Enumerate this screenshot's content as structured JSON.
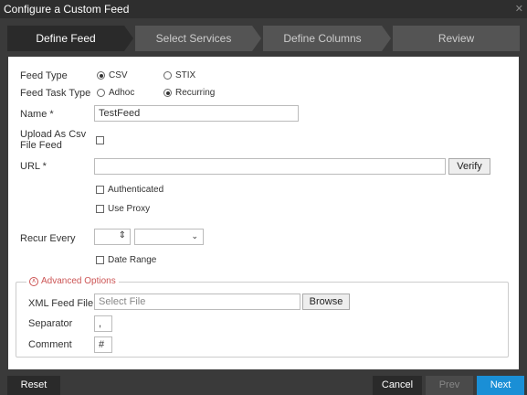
{
  "window": {
    "title": "Configure a Custom Feed",
    "close_icon": "close-icon"
  },
  "wizard": {
    "steps": [
      {
        "label": "Define Feed",
        "active": true
      },
      {
        "label": "Select Services",
        "active": false
      },
      {
        "label": "Define Columns",
        "active": false
      },
      {
        "label": "Review",
        "active": false
      }
    ]
  },
  "form": {
    "feed_type": {
      "label": "Feed Type",
      "options": [
        "CSV",
        "STIX"
      ],
      "selected": "CSV"
    },
    "feed_task_type": {
      "label": "Feed Task Type",
      "options": [
        "Adhoc",
        "Recurring"
      ],
      "selected": "Recurring"
    },
    "name": {
      "label": "Name *",
      "value": "TestFeed"
    },
    "upload_csv": {
      "label_line1": "Upload As Csv",
      "label_line2": "File Feed"
    },
    "url": {
      "label": "URL *",
      "value": "",
      "verify_label": "Verify"
    },
    "authenticated": {
      "label": "Authenticated"
    },
    "use_proxy": {
      "label": "Use Proxy"
    },
    "recur_every": {
      "label": "Recur Every",
      "value": "",
      "unit": ""
    },
    "date_range": {
      "label": "Date Range"
    },
    "advanced": {
      "legend": "Advanced Options",
      "xml_feed_file": {
        "label": "XML Feed File",
        "placeholder": "Select File",
        "browse_label": "Browse"
      },
      "separator": {
        "label": "Separator",
        "value": ","
      },
      "comment": {
        "label": "Comment",
        "value": "#"
      }
    }
  },
  "footer": {
    "reset_label": "Reset",
    "cancel_label": "Cancel",
    "prev_label": "Prev",
    "next_label": "Next"
  },
  "colors": {
    "accent": "#1a8fd6",
    "active_step": "#2a2a2a",
    "inactive_step": "#545454",
    "advanced_legend": "#cc5555"
  }
}
